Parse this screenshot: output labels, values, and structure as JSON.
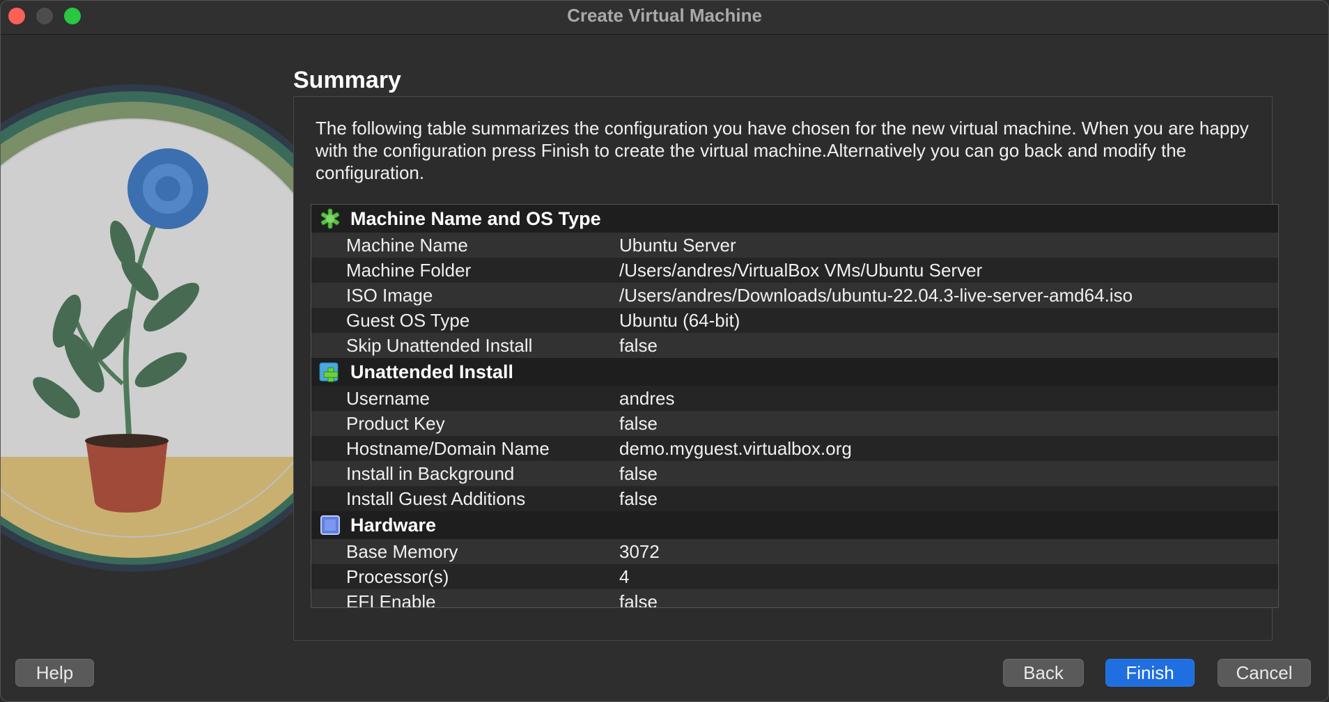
{
  "window": {
    "title": "Create Virtual Machine"
  },
  "page": {
    "heading": "Summary",
    "description": "The following table summarizes the configuration you have chosen for the new virtual machine. When you are happy with the configuration press Finish to create the virtual machine.Alternatively you can go back and modify the configuration."
  },
  "sections": [
    {
      "title": "Machine Name and OS Type",
      "icon": "green-gear-icon",
      "rows": [
        {
          "key": "Machine Name",
          "value": "Ubuntu Server"
        },
        {
          "key": "Machine Folder",
          "value": "/Users/andres/VirtualBox VMs/Ubuntu Server"
        },
        {
          "key": "ISO Image",
          "value": "/Users/andres/Downloads/ubuntu-22.04.3-live-server-amd64.iso"
        },
        {
          "key": "Guest OS Type",
          "value": "Ubuntu (64-bit)"
        },
        {
          "key": "Skip Unattended Install",
          "value": "false"
        }
      ]
    },
    {
      "title": "Unattended Install",
      "icon": "install-plus-icon",
      "rows": [
        {
          "key": "Username",
          "value": "andres"
        },
        {
          "key": "Product Key",
          "value": "false"
        },
        {
          "key": "Hostname/Domain Name",
          "value": "demo.myguest.virtualbox.org"
        },
        {
          "key": "Install in Background",
          "value": "false"
        },
        {
          "key": "Install Guest Additions",
          "value": "false"
        }
      ]
    },
    {
      "title": "Hardware",
      "icon": "chip-icon",
      "rows": [
        {
          "key": "Base Memory",
          "value": "3072"
        },
        {
          "key": "Processor(s)",
          "value": "4"
        },
        {
          "key": "EFI Enable",
          "value": "false"
        }
      ]
    }
  ],
  "buttons": {
    "help": "Help",
    "back": "Back",
    "finish": "Finish",
    "cancel": "Cancel"
  },
  "colors": {
    "accent": "#1f6fe0",
    "close": "#fe5f57",
    "maximize": "#28c840"
  }
}
